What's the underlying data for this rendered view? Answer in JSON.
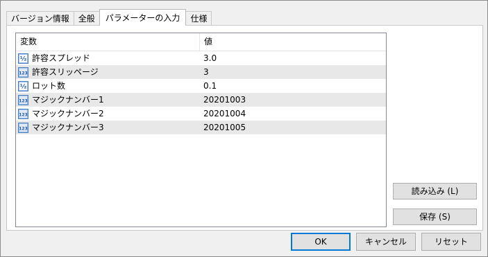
{
  "tabs": [
    {
      "label": "バージョン情報"
    },
    {
      "label": "全般"
    },
    {
      "label": "パラメーターの入力"
    },
    {
      "label": "仕様"
    }
  ],
  "table": {
    "headers": [
      "変数",
      "値"
    ],
    "rows": [
      {
        "name": "許容スプレッド",
        "value": "3.0",
        "type_icon": "double-type-icon"
      },
      {
        "name": "許容スリッページ",
        "value": "3",
        "type_icon": "integer-type-icon"
      },
      {
        "name": "ロット数",
        "value": "0.1",
        "type_icon": "double-type-icon"
      },
      {
        "name": "マジックナンバー1",
        "value": "20201003",
        "type_icon": "integer-type-icon"
      },
      {
        "name": "マジックナンバー2",
        "value": "20201004",
        "type_icon": "integer-type-icon"
      },
      {
        "name": "マジックナンバー3",
        "value": "20201005",
        "type_icon": "integer-type-icon"
      }
    ]
  },
  "icon_text": {
    "double": "½",
    "integer": "123"
  },
  "buttons": {
    "load": "読み込み (L)",
    "save": "保存 (S)",
    "ok": "OK",
    "cancel": "キャンセル",
    "reset": "リセット"
  },
  "colors": {
    "default_button_border": "#0078d7",
    "alt_row": "#e8e8e8",
    "dialog_bg": "#f0f0f0"
  }
}
